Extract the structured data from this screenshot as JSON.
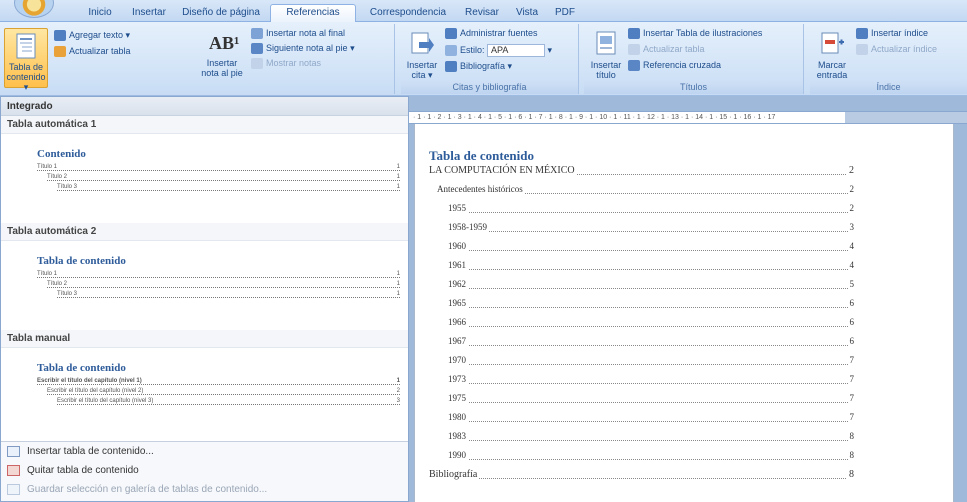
{
  "tabs": [
    "Inicio",
    "Insertar",
    "Diseño de página",
    "Referencias",
    "Correspondencia",
    "Revisar",
    "Vista",
    "PDF"
  ],
  "active_tab": "Referencias",
  "ribbon": {
    "toc_button": "Tabla de contenido",
    "add_text": "Agregar texto",
    "update_table": "Actualizar tabla",
    "insert_footnote": "Insertar nota al pie",
    "insert_endnote": "Insertar nota al final",
    "next_footnote": "Siguiente nota al pie",
    "show_notes": "Mostrar notas",
    "insert_citation": "Insertar cita",
    "manage_sources": "Administrar fuentes",
    "style_label": "Estilo:",
    "style_value": "APA",
    "bibliography": "Bibliografía",
    "citations_group": "Citas y bibliografía",
    "insert_caption": "Insertar título",
    "insert_table_figures": "Insertar Tabla de ilustraciones",
    "update_table_2": "Actualizar tabla",
    "cross_reference": "Referencia cruzada",
    "captions_group": "Títulos",
    "mark_entry": "Marcar entrada",
    "insert_index": "Insertar índice",
    "update_index": "Actualizar índice",
    "index_group": "Índice"
  },
  "gallery": {
    "header": "Integrado",
    "sections": [
      {
        "name": "Tabla automática 1",
        "title": "Contenido",
        "lines": [
          {
            "label": "Título 1",
            "page": "1"
          },
          {
            "label": "Título 2",
            "page": "1"
          },
          {
            "label": "Título 3",
            "page": "1"
          }
        ]
      },
      {
        "name": "Tabla automática 2",
        "title": "Tabla de contenido",
        "lines": [
          {
            "label": "Título 1",
            "page": "1"
          },
          {
            "label": "Título 2",
            "page": "1"
          },
          {
            "label": "Título 3",
            "page": "1"
          }
        ]
      },
      {
        "name": "Tabla manual",
        "title": "Tabla de contenido",
        "lines": [
          {
            "label": "Escribir el título del capítulo (nivel 1)",
            "page": "1"
          },
          {
            "label": "Escribir el título del capítulo (nivel 2)",
            "page": "2"
          },
          {
            "label": "Escribir el título del capítulo (nivel 3)",
            "page": "3"
          }
        ]
      }
    ],
    "menu": [
      {
        "label": "Insertar tabla de contenido...",
        "enabled": true
      },
      {
        "label": "Quitar tabla de contenido",
        "enabled": true
      },
      {
        "label": "Guardar selección en galería de tablas de contenido...",
        "enabled": false
      }
    ]
  },
  "ruler_text": "· 1 · 1 · 2 · 1 · 3 · 1 · 4 · 1 · 5 · 1 · 6 · 1 · 7 · 1 · 8 · 1 · 9 · 1 · 10 · 1 · 11 · 1 · 12 · 1 · 13 · 1 · 14 · 1 · 15 · 1 · 16 · 1 · 17",
  "document": {
    "title": "Tabla de contenido",
    "entries": [
      {
        "label": "LA COMPUTACIÓN EN MÉXICO",
        "page": "2",
        "level": 1
      },
      {
        "label": "Antecedentes históricos",
        "page": "2",
        "level": 2
      },
      {
        "label": "1955",
        "page": "2",
        "level": 3
      },
      {
        "label": "1958-1959",
        "page": "3",
        "level": 3
      },
      {
        "label": "1960",
        "page": "4",
        "level": 3
      },
      {
        "label": "1961",
        "page": "4",
        "level": 3
      },
      {
        "label": "1962",
        "page": "5",
        "level": 3
      },
      {
        "label": "1965",
        "page": "6",
        "level": 3
      },
      {
        "label": "1966",
        "page": "6",
        "level": 3
      },
      {
        "label": "1967",
        "page": "6",
        "level": 3
      },
      {
        "label": "1970",
        "page": "7",
        "level": 3
      },
      {
        "label": "1973",
        "page": "7",
        "level": 3
      },
      {
        "label": "1975",
        "page": "7",
        "level": 3
      },
      {
        "label": "1980",
        "page": "7",
        "level": 3
      },
      {
        "label": "1983",
        "page": "8",
        "level": 3
      },
      {
        "label": "1990",
        "page": "8",
        "level": 3
      },
      {
        "label": "Bibliografía",
        "page": "8",
        "level": 1
      }
    ]
  }
}
